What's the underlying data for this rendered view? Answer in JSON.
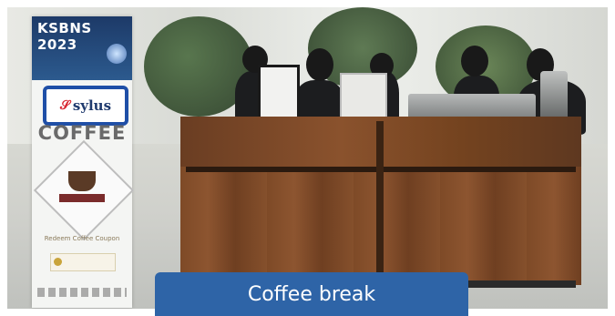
{
  "banner": {
    "title": "KSBNS 2023",
    "logo_mark": "𝒮",
    "logo_text": "sylus",
    "heading": "COFFEE",
    "redeem_text": "Redeem Coffee Coupon"
  },
  "caption": {
    "text": "Coffee break",
    "color": "#2e64a7"
  },
  "accents": {
    "logo_outline": "#1f4fa7"
  }
}
